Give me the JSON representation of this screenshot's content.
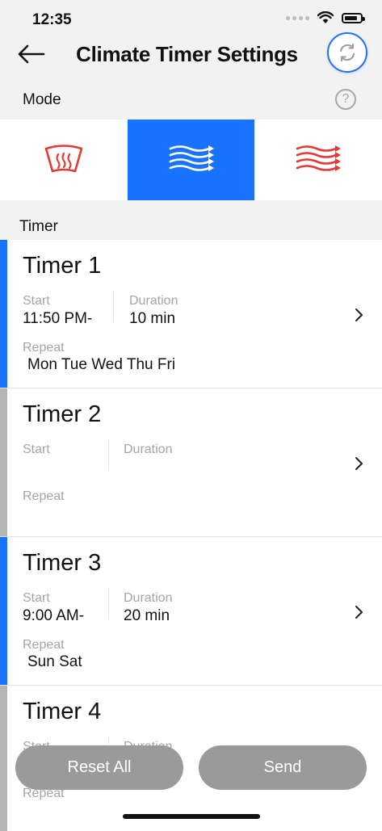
{
  "status_bar": {
    "time": "12:35"
  },
  "header": {
    "title": "Climate Timer Settings"
  },
  "mode": {
    "label": "Mode",
    "help_glyph": "?",
    "tabs": [
      {
        "name": "defrost",
        "icon": "windshield-defrost-icon",
        "active": false,
        "color": "#e53935"
      },
      {
        "name": "vent",
        "icon": "airflow-icon",
        "active": true,
        "color": "#ffffff"
      },
      {
        "name": "heat",
        "icon": "heat-flow-icon",
        "active": false,
        "color": "#e53935"
      }
    ]
  },
  "timer": {
    "section_label": "Timer",
    "start_label": "Start",
    "duration_label": "Duration",
    "repeat_label": "Repeat",
    "items": [
      {
        "name": "Timer 1",
        "start": "11:50 PM-",
        "duration": "10 min",
        "repeat": "Mon Tue Wed Thu Fri",
        "enabled": true
      },
      {
        "name": "Timer 2",
        "start": "",
        "duration": "",
        "repeat": "",
        "enabled": false
      },
      {
        "name": "Timer 3",
        "start": "9:00 AM-",
        "duration": "20 min",
        "repeat": "Sun Sat",
        "enabled": true
      },
      {
        "name": "Timer 4",
        "start": "",
        "duration": "",
        "repeat": "",
        "enabled": false
      }
    ]
  },
  "actions": {
    "reset_label": "Reset All",
    "send_label": "Send"
  },
  "colors": {
    "accent": "#1a73ff",
    "disabled": "#b5b5b5",
    "mode_icon_red": "#e53935"
  }
}
